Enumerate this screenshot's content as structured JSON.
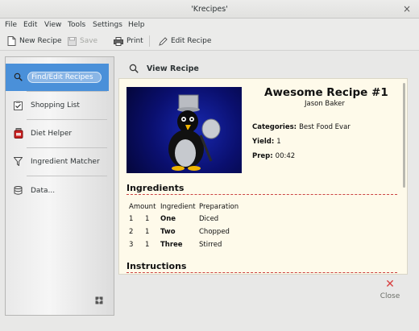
{
  "window": {
    "title": "'Krecipes'",
    "close_glyph": "×"
  },
  "menu": [
    "File",
    "Edit",
    "View",
    "Tools",
    "Settings",
    "Help"
  ],
  "toolbar": {
    "new_recipe": "New Recipe",
    "save": "Save",
    "print": "Print",
    "edit_recipe": "Edit Recipe"
  },
  "sidebar": {
    "items": [
      {
        "label": "Find/Edit Recipes",
        "icon": "search-icon",
        "active": true
      },
      {
        "label": "Shopping List",
        "icon": "clipboard-icon"
      },
      {
        "label": "Diet Helper",
        "icon": "diet-jar-icon"
      },
      {
        "label": "Ingredient Matcher",
        "icon": "funnel-icon"
      },
      {
        "label": "Data...",
        "icon": "database-icon"
      }
    ]
  },
  "view": {
    "title": "View Recipe",
    "icon": "search-icon"
  },
  "recipe": {
    "title": "Awesome Recipe #1",
    "author": "Jason Baker",
    "categories_label": "Categories:",
    "categories": "Best Food Evar",
    "yield_label": "Yield:",
    "yield": "1",
    "prep_label": "Prep:",
    "prep": "00:42",
    "ingredients_title": "Ingredients",
    "ingredients_headers": [
      "Amount",
      "Ingredient",
      "Preparation"
    ],
    "ingredients": [
      {
        "n": "1",
        "amount": "1",
        "ingredient": "One",
        "prep": "Diced"
      },
      {
        "n": "2",
        "amount": "1",
        "ingredient": "Two",
        "prep": "Chopped"
      },
      {
        "n": "3",
        "amount": "1",
        "ingredient": "Three",
        "prep": "Stirred"
      }
    ],
    "instructions_title": "Instructions",
    "photo": "penguin-chef-image"
  },
  "close": {
    "label": "Close",
    "glyph": "✕"
  },
  "colors": {
    "accent": "#4a90d9",
    "content_bg": "#fefaea",
    "rule": "#cc4444"
  }
}
